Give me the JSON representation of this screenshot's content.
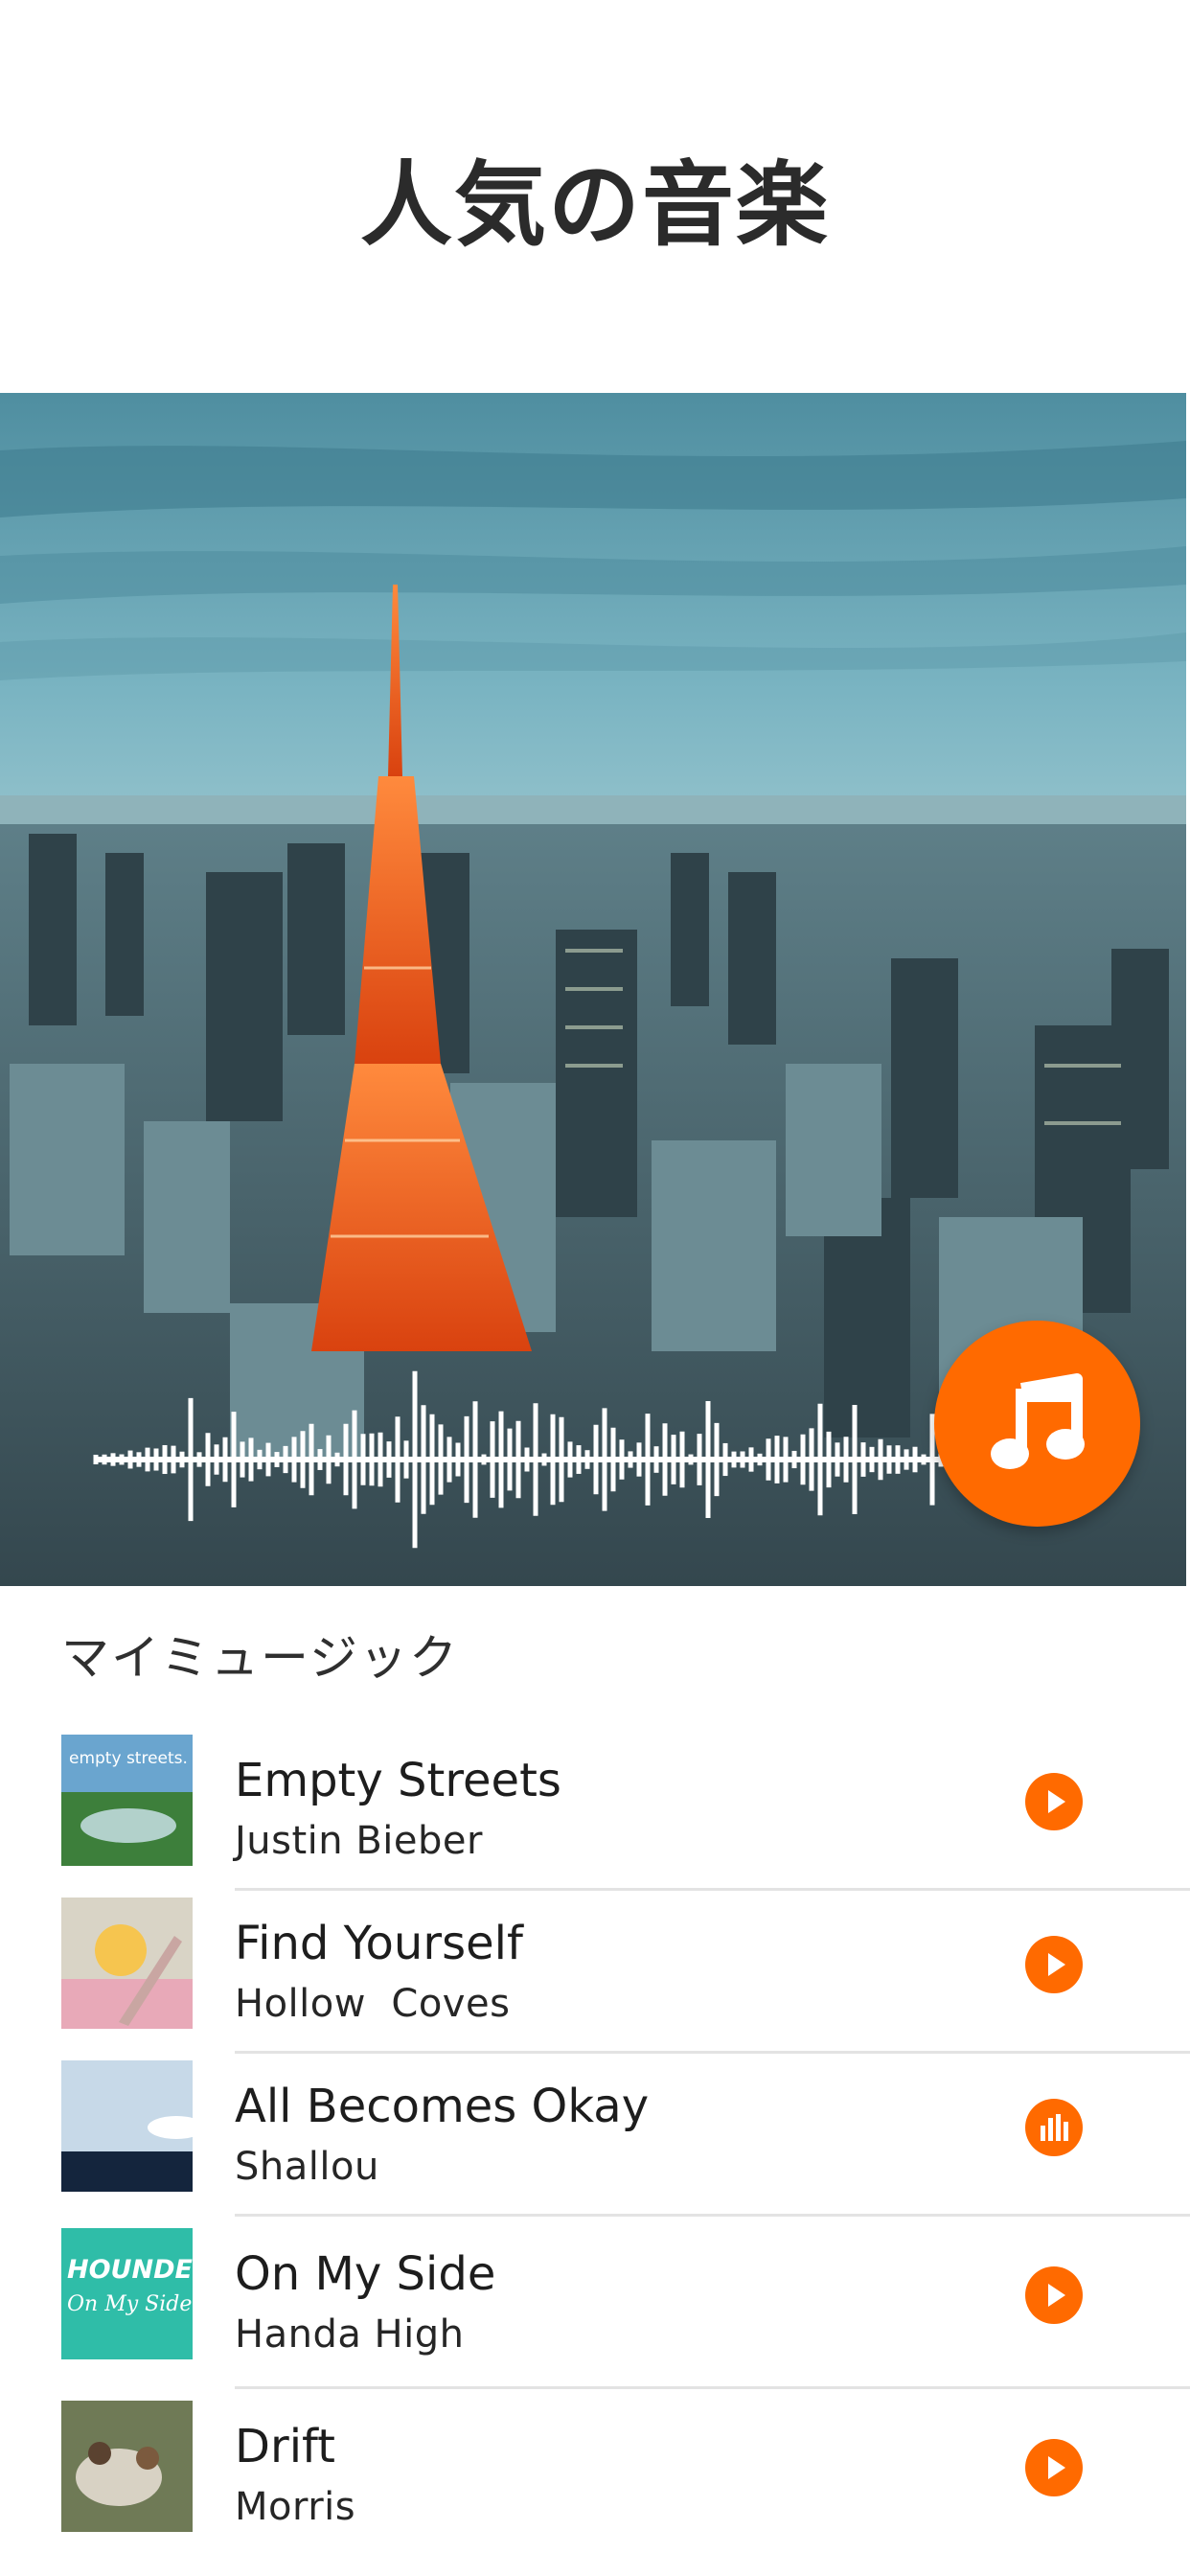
{
  "header": {
    "title": "人気の音楽"
  },
  "hero": {
    "icons": [
      "tokyo-skyline-photo",
      "audio-waveform",
      "music-note-icon"
    ]
  },
  "section": {
    "title": "マイミュージック"
  },
  "tracks": [
    {
      "title": "Empty Streets",
      "artist": "Justin Bieber",
      "cover_text": "empty streets.",
      "action": "play-icon"
    },
    {
      "title": "Find Yourself",
      "artist": "Hollow  Coves",
      "cover_text": "",
      "action": "play-icon"
    },
    {
      "title": "All Becomes Okay",
      "artist": "Shallou",
      "cover_text": "",
      "action": "equalizer-icon"
    },
    {
      "title": "On My Side",
      "artist": "Handa High",
      "cover_text": "HOUNDED",
      "cover_text2": "On My Side",
      "action": "play-icon"
    },
    {
      "title": "Drift",
      "artist": "Morris",
      "cover_text": "",
      "action": "play-icon"
    }
  ],
  "colors": {
    "accent": "#ff6a00",
    "text": "#1f1f1f",
    "divider": "#e3e3e3"
  }
}
